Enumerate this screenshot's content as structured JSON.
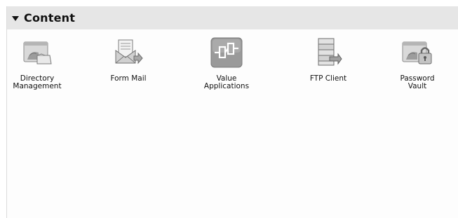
{
  "section": {
    "title": "Content"
  },
  "items": [
    {
      "label": "Directory\nManagement",
      "icon": "directory-management-icon"
    },
    {
      "label": "Form Mail",
      "icon": "form-mail-icon"
    },
    {
      "label": "Value\nApplications",
      "icon": "value-applications-icon"
    },
    {
      "label": "FTP Client",
      "icon": "ftp-client-icon"
    },
    {
      "label": "Password\nVault",
      "icon": "password-vault-icon"
    }
  ]
}
